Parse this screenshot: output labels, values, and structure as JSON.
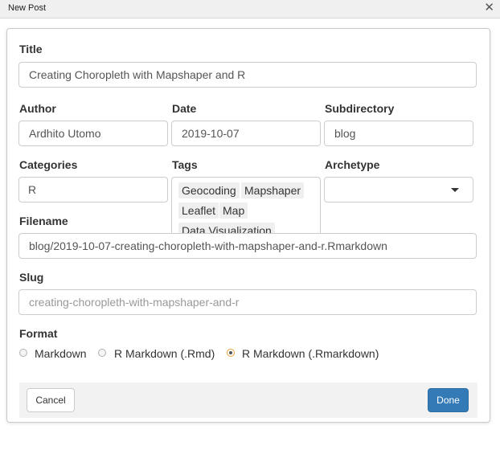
{
  "window": {
    "title": "New Post",
    "close_icon": "close-icon"
  },
  "form": {
    "title": {
      "label": "Title",
      "value": "Creating Choropleth with Mapshaper and R"
    },
    "author": {
      "label": "Author",
      "value": "Ardhito Utomo"
    },
    "date": {
      "label": "Date",
      "value": "2019-10-07"
    },
    "subdirectory": {
      "label": "Subdirectory",
      "value": "blog"
    },
    "categories": {
      "label": "Categories",
      "items": [
        "R"
      ]
    },
    "tags": {
      "label": "Tags",
      "items": [
        "Geocoding",
        "Mapshaper",
        "Leaflet",
        "Map",
        "Data Visualization"
      ]
    },
    "archetype": {
      "label": "Archetype",
      "value": ""
    },
    "filename": {
      "label": "Filename",
      "value": "blog/2019-10-07-creating-choropleth-with-mapshaper-and-r.Rmarkdown"
    },
    "slug": {
      "label": "Slug",
      "placeholder": "creating-choropleth-with-mapshaper-and-r"
    },
    "format": {
      "label": "Format",
      "options": [
        "Markdown",
        "R Markdown (.Rmd)",
        "R Markdown (.Rmarkdown)"
      ],
      "selected": "R Markdown (.Rmarkdown)"
    }
  },
  "buttons": {
    "cancel": "Cancel",
    "done": "Done"
  },
  "colors": {
    "primary": "#337ab7",
    "radio_focus": "#ee9e3c"
  }
}
